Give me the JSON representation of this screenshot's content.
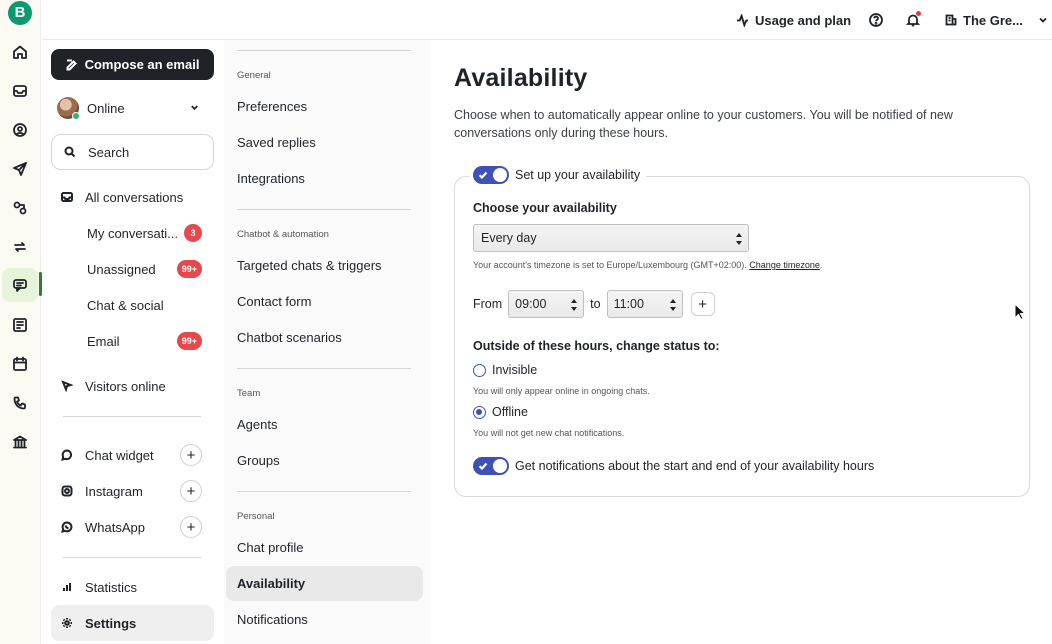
{
  "topbar": {
    "usage_label": "Usage and plan",
    "org_label": "The Gre..."
  },
  "rail": {
    "logo": "B",
    "icons": [
      "home-icon",
      "inbox-icon",
      "contacts-icon",
      "send-icon",
      "automation-icon",
      "sync-icon",
      "conversations-icon",
      "forms-icon",
      "calendar-icon",
      "phone-icon",
      "bank-icon"
    ]
  },
  "sidebar": {
    "compose_label": "Compose an email",
    "status_label": "Online",
    "search_label": "Search",
    "all_conversations": "All conversations",
    "my_conversations": "My conversati...",
    "my_conversations_badge": "3",
    "unassigned": "Unassigned",
    "unassigned_badge": "99+",
    "chat_social": "Chat & social",
    "email": "Email",
    "email_badge": "99+",
    "visitors_online": "Visitors online",
    "chat_widget": "Chat widget",
    "instagram": "Instagram",
    "whatsapp": "WhatsApp",
    "plus": "+",
    "statistics": "Statistics",
    "settings": "Settings"
  },
  "settings_nav": {
    "general_header": "General",
    "preferences": "Preferences",
    "saved_replies": "Saved replies",
    "integrations": "Integrations",
    "chatbot_header": "Chatbot & automation",
    "targeted_chats": "Targeted chats & triggers",
    "contact_form": "Contact form",
    "chatbot_scenarios": "Chatbot scenarios",
    "team_header": "Team",
    "agents": "Agents",
    "groups": "Groups",
    "personal_header": "Personal",
    "chat_profile": "Chat profile",
    "availability": "Availability",
    "notifications": "Notifications"
  },
  "main": {
    "title": "Availability",
    "description": "Choose when to automatically appear online to your customers. You will be notified of new conversations only during these hours.",
    "setup_label": "Set up your availability",
    "choose_label": "Choose your availability",
    "availability_value": "Every day",
    "timezone_text": "Your account's timezone is set to Europe/Luxembourg (GMT+02:00).",
    "timezone_link": "Change timezone",
    "timezone_end": ".",
    "from_label": "From",
    "from_value": "09:00",
    "to_label": "to",
    "to_value": "11:00",
    "add_label": "+",
    "outside_label": "Outside of these hours, change status to:",
    "invisible_label": "Invisible",
    "invisible_hint": "You will only appear online in ongoing chats.",
    "offline_label": "Offline",
    "offline_hint": "You will not get new chat notifications.",
    "notify_label": "Get notifications about the start and end of your availability hours",
    "selected_status": "Offline"
  }
}
